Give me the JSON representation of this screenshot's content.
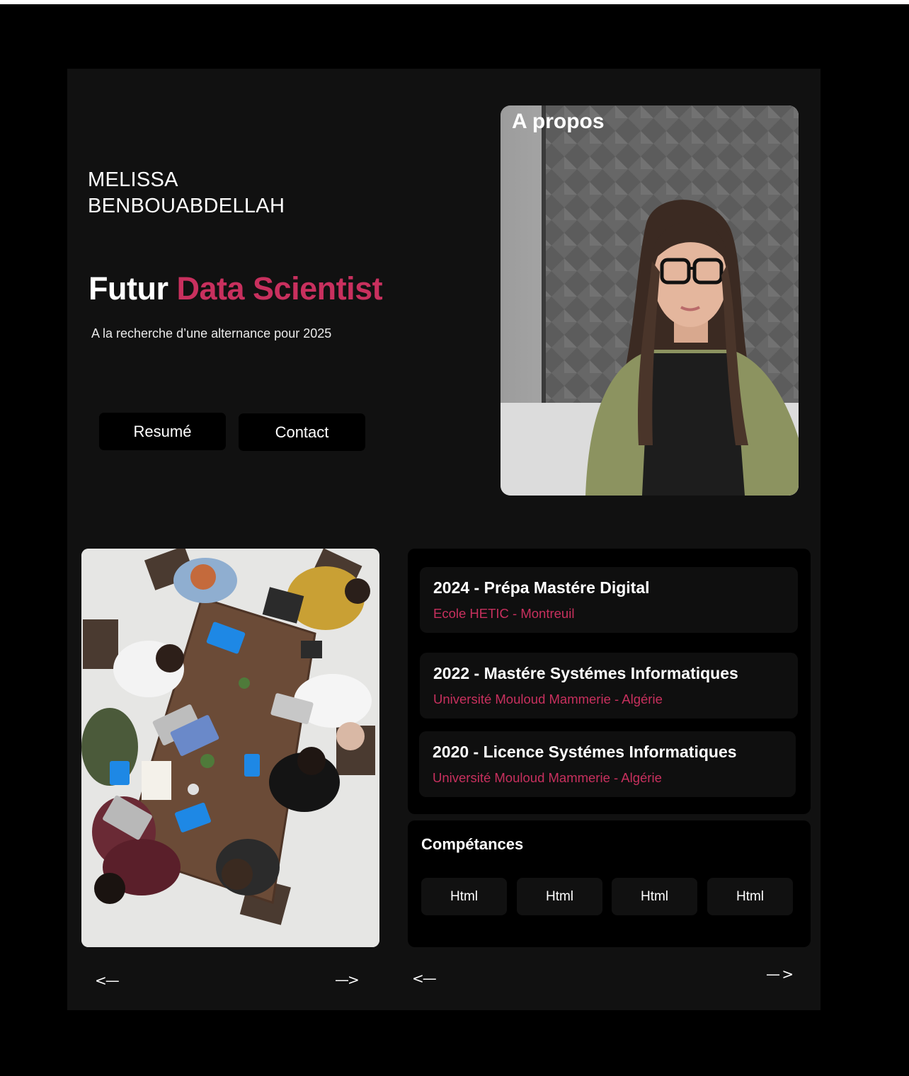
{
  "hero": {
    "name_line1": "MELISSA",
    "name_line2": "BENBOUABDELLAH",
    "headline_prefix": "Futur",
    "headline_accent": "Data Scientist",
    "subtitle": "A la recherche d’une alternance pour 2025",
    "resume_label": "Resumé",
    "contact_label": "Contact"
  },
  "about": {
    "title": "A propos"
  },
  "gallery_nav": {
    "prev": "<—",
    "next": "—>"
  },
  "education": [
    {
      "title": "2024 - Prépa Mastére Digital",
      "school": "Ecole HETIC - Montreuil"
    },
    {
      "title": "2022 - Mastére Systémes Informatiques",
      "school": "Université Mouloud Mammerie - Algérie"
    },
    {
      "title": "2020 - Licence Systémes Informatiques",
      "school": "Université Mouloud Mammerie - Algérie"
    }
  ],
  "skills": {
    "title": "Compétances",
    "items": [
      "Html",
      "Html",
      "Html",
      "Html"
    ]
  },
  "skills_nav": {
    "prev": "<—",
    "next": "— >"
  },
  "colors": {
    "accent": "#c8305e",
    "page_bg": "#000000",
    "frame_bg": "#111111"
  }
}
